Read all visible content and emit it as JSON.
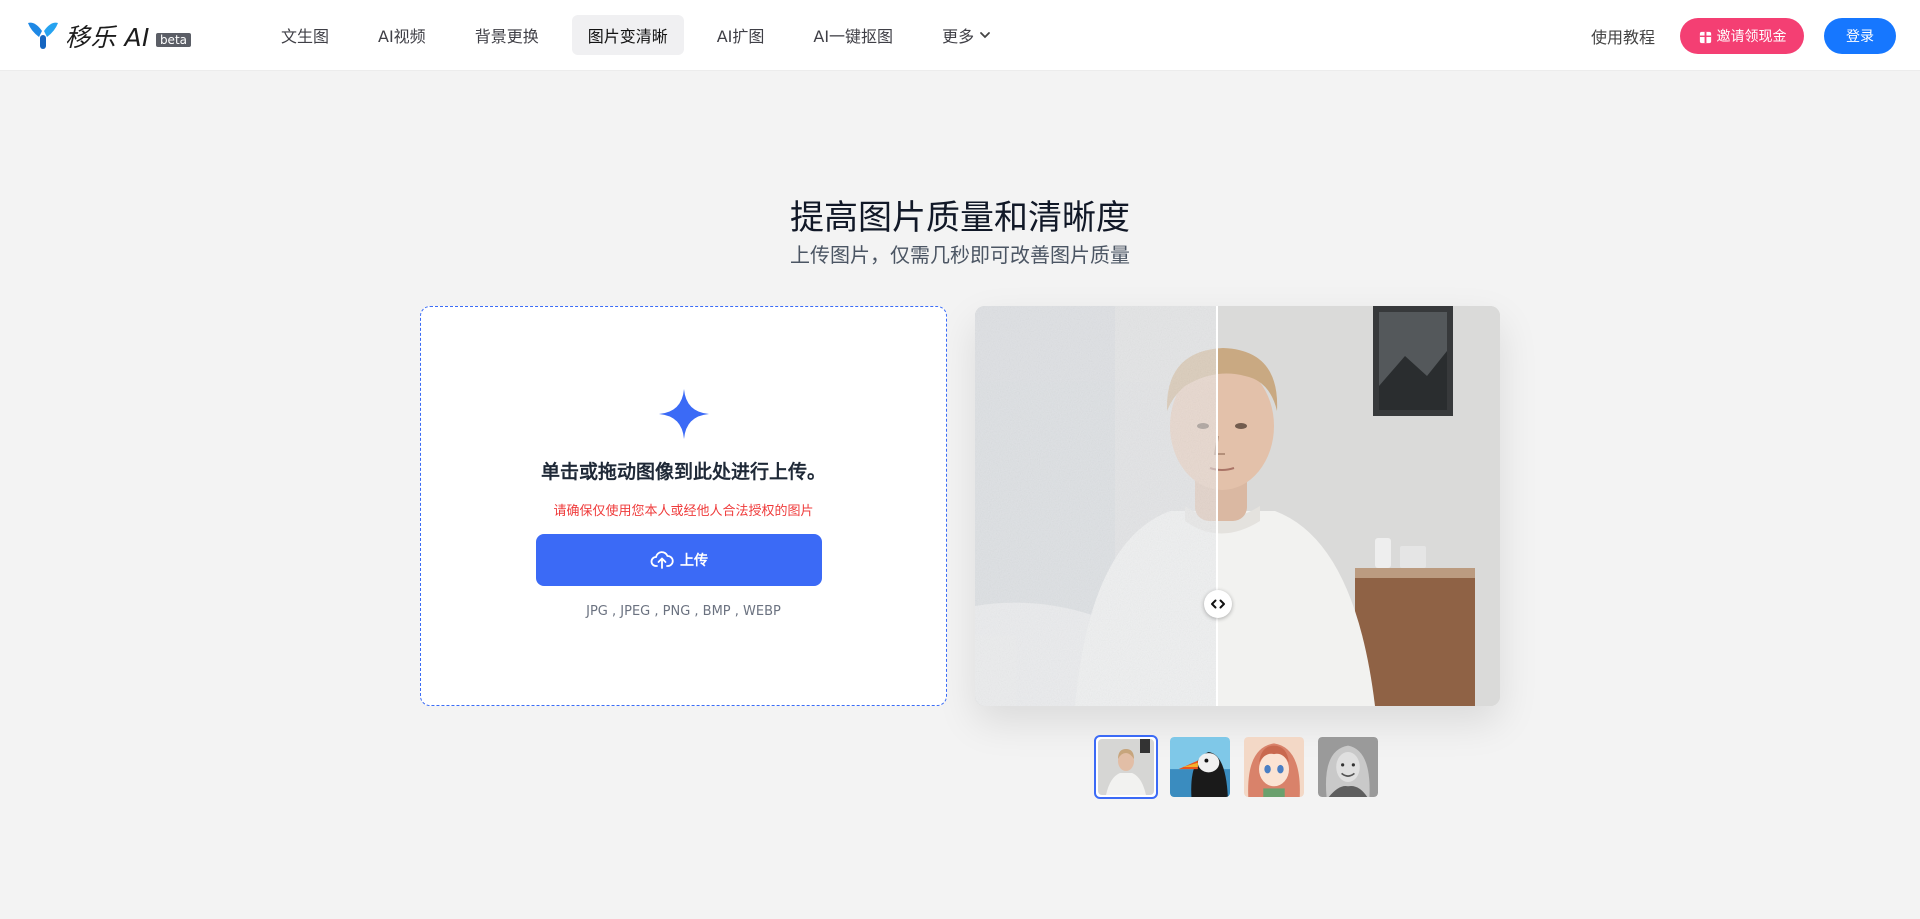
{
  "header": {
    "brand": "移乐 AI",
    "beta_badge": "beta",
    "nav": [
      {
        "label": "文生图"
      },
      {
        "label": "AI视频"
      },
      {
        "label": "背景更换"
      },
      {
        "label": "图片变清晰",
        "active": true
      },
      {
        "label": "AI扩图"
      },
      {
        "label": "AI一键抠图"
      },
      {
        "label": "更多"
      }
    ],
    "tutorial": "使用教程",
    "invite": "邀请领现金",
    "login": "登录"
  },
  "hero": {
    "title": "提高图片质量和清晰度",
    "subtitle": "上传图片，仅需几秒即可改善图片质量"
  },
  "upload": {
    "drop_text": "单击或拖动图像到此处进行上传。",
    "warning": "请确保仅使用您本人或经他人合法授权的图片",
    "button": "上传",
    "formats": "JPG , JPEG , PNG , BMP , WEBP"
  },
  "thumbnails": [
    {
      "name": "young-man-thumbnail",
      "active": true
    },
    {
      "name": "puffin-thumbnail",
      "active": false
    },
    {
      "name": "anime-girl-thumbnail",
      "active": false
    },
    {
      "name": "woman-bw-thumbnail",
      "active": false
    }
  ],
  "colors": {
    "primary": "#3b6af6",
    "invite": "#f43f73",
    "login": "#1677ff",
    "warning": "#ef3b3b",
    "background": "#f3f3f3"
  },
  "icons": [
    "logo-icon",
    "chevron-down-icon",
    "gift-icon",
    "sparkle-icon",
    "cloud-upload-icon",
    "compare-arrows-icon"
  ]
}
